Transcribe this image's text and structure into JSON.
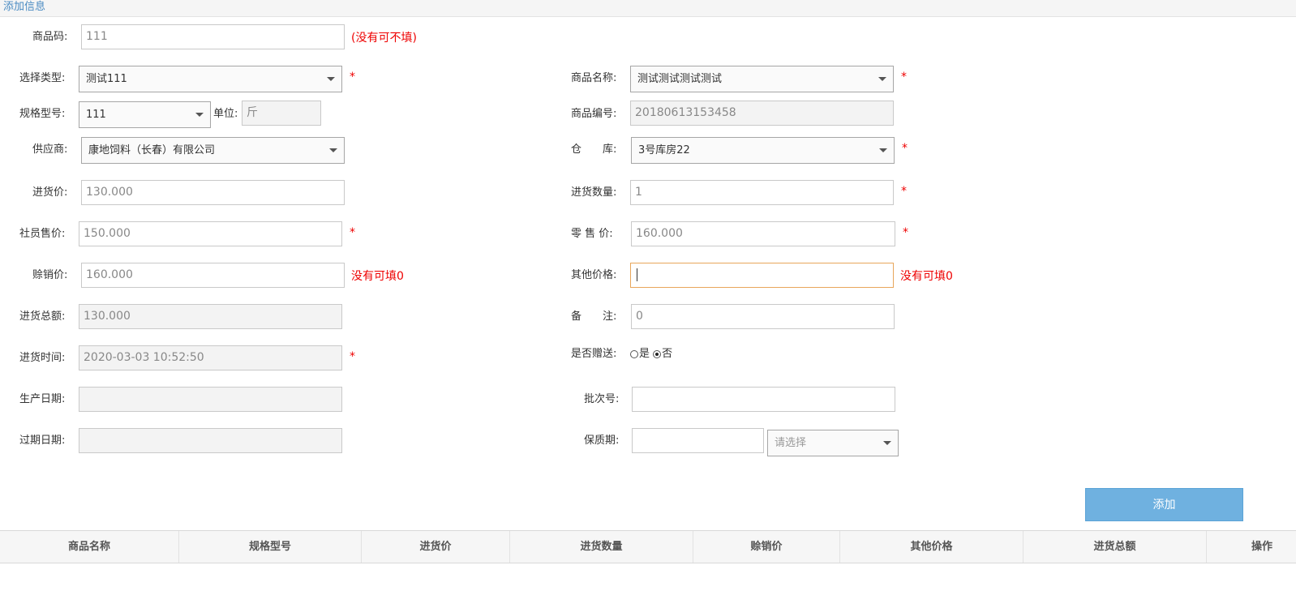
{
  "header": {
    "title": "添加信息"
  },
  "form": {
    "product_code": {
      "label": "商品码:",
      "value": "111",
      "hint": "(没有可不填)"
    },
    "type": {
      "label": "选择类型:",
      "value": "测试111",
      "required": "*"
    },
    "product_name": {
      "label": "商品名称:",
      "value": "测试测试测试测试",
      "required": "*"
    },
    "spec": {
      "label": "规格型号:",
      "value": "111"
    },
    "unit": {
      "label": "单位:",
      "value": "斤"
    },
    "product_no": {
      "label": "商品编号:",
      "value": "20180613153458"
    },
    "supplier": {
      "label": "供应商:",
      "value": "康地饲料（长春）有限公司"
    },
    "warehouse": {
      "label": "仓　　库:",
      "value": "3号库房22",
      "required": "*"
    },
    "purchase_price": {
      "label": "进货价:",
      "value": "130.000"
    },
    "purchase_qty": {
      "label": "进货数量:",
      "value": "1",
      "required": "*"
    },
    "member_price": {
      "label": "社员售价:",
      "value": "150.000",
      "required": "*"
    },
    "retail_price": {
      "label": "零 售 价:",
      "value": "160.000",
      "required": "*"
    },
    "credit_price": {
      "label": "赊销价:",
      "value": "160.000",
      "hint": "没有可填0"
    },
    "other_price": {
      "label": "其他价格:",
      "value": "",
      "hint": "没有可填0"
    },
    "purchase_total": {
      "label": "进货总额:",
      "value": "130.000"
    },
    "remark": {
      "label": "备　　注:",
      "value": "0"
    },
    "purchase_time": {
      "label": "进货时间:",
      "value": "2020-03-03 10:52:50",
      "required": "*"
    },
    "gift": {
      "label": "是否赠送:",
      "yes": "是",
      "no": "否"
    },
    "production_date": {
      "label": "生产日期:",
      "value": ""
    },
    "batch_no": {
      "label": "批次号:",
      "value": ""
    },
    "expiry_date": {
      "label": "过期日期:",
      "value": ""
    },
    "shelf_life": {
      "label": "保质期:",
      "value": "",
      "unit_placeholder": "请选择"
    }
  },
  "actions": {
    "add_label": "添加"
  },
  "table": {
    "columns": [
      "商品名称",
      "规格型号",
      "进货价",
      "进货数量",
      "赊销价",
      "其他价格",
      "进货总额",
      "操作"
    ]
  }
}
